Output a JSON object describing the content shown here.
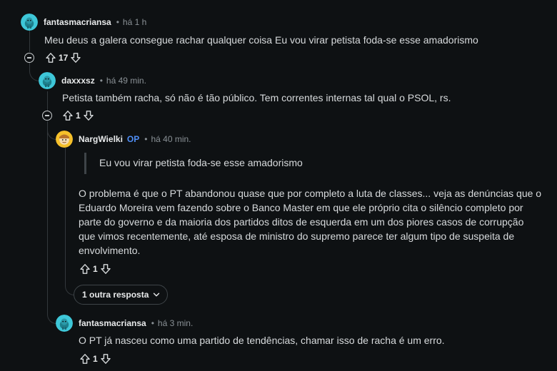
{
  "comments": [
    {
      "author": "fantasmacriansa",
      "time": "há 1 h",
      "text": "Meu deus a galera consegue rachar qualquer coisa Eu vou virar petista foda-se esse amadorismo",
      "votes": "17"
    },
    {
      "author": "daxxxsz",
      "time": "há 49 min.",
      "text": "Petista também racha, só não é tão público. Tem correntes internas tal qual o PSOL, rs.",
      "votes": "1"
    },
    {
      "author": "NargWielki",
      "op_badge": "OP",
      "time": "há 40 min.",
      "quote": "Eu vou virar petista foda-se esse amadorismo",
      "lines": [
        "O problema é que o PT abandonou quase que por completo a luta de classes... veja as denúncias que o",
        "Eduardo Moreira vem fazendo sobre o Banco Master em que ele próprio cita o silêncio completo por",
        "parte do governo e da maioria dos partidos ditos de esquerda em um dos piores casos de corrupção",
        "que vimos recentemente, até esposa de ministro do supremo parece ter algum tipo de suspeita de",
        "envolvimento."
      ],
      "votes": "1"
    },
    {
      "author": "fantasmacriansa",
      "time": "há 3 min.",
      "text": "O PT já nasceu como uma partido de tendências, chamar isso de racha é um erro.",
      "votes": "1"
    }
  ],
  "more_replies_label": "1 outra resposta",
  "separator": "•",
  "colors": {
    "background": "#0e1113",
    "thread_line": "#33383c",
    "avatar_teal": "#3ec7d8",
    "avatar_yellow": "#f5c02b",
    "op_blue": "#4f8ff7"
  }
}
